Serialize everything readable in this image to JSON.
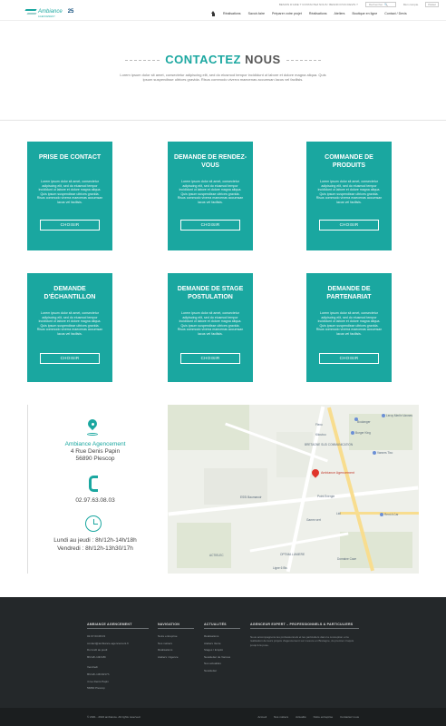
{
  "topbar": {
    "line": "BESOIN D'AIDE ? CONTACTEZ NOUS ! BESOIN D'UN DEVIS ?",
    "search_placeholder": "Rechercher",
    "account": "Mon compte",
    "panier": "Panier"
  },
  "logo": {
    "word": "Ambiance",
    "sub": "AGENCEMENT",
    "badge": "25"
  },
  "nav": {
    "items": [
      "Réalisations",
      "Savoir-faire",
      "Préparer votre projet",
      "Réalisations",
      "Ateliers",
      "Boutique en ligne",
      "Contact / Devis"
    ]
  },
  "hero": {
    "title_1": "CONTACTEZ",
    "title_2": "NOUS",
    "text": "Lorem ipsum dolor sit amet, consectetur adipiscing elit, sed do eiusmod tempor incididunt ut labore et dolore magna aliqua. Quis ipsum suspendisse ultrices gravida. Risus commodo viverra maecenas accumsan lacus vel facilisis."
  },
  "cards": [
    {
      "title": "PRISE DE CONTACT",
      "text": "Lorem ipsum dolor sit amet, consectetur adipiscing elit, sed do eiusmod tempor incididunt ut labore et dolore magna aliqua. Quis ipsum suspendisse ultrices gravida. Risus commodo viverra maecenas accumsan lacus vel facilisis.",
      "button": "CHOISIR"
    },
    {
      "title": "DEMANDE DE RENDEZ-VOUS",
      "text": "Lorem ipsum dolor sit amet, consectetur adipiscing elit, sed do eiusmod tempor incididunt ut labore et dolore magna aliqua. Quis ipsum suspendisse ultrices gravida. Risus commodo viverra maecenas accumsan lacus vel facilisis.",
      "button": "CHOISIR"
    },
    {
      "title": "COMMANDE DE PRODUITS",
      "text": "Lorem ipsum dolor sit amet, consectetur adipiscing elit, sed do eiusmod tempor incididunt ut labore et dolore magna aliqua. Quis ipsum suspendisse ultrices gravida. Risus commodo viverra maecenas accumsan lacus vel facilisis.",
      "button": "CHOISIR"
    },
    {
      "title": "DEMANDE D'ÉCHANTILLON",
      "text": "Lorem ipsum dolor sit amet, consectetur adipiscing elit, sed do eiusmod tempor incididunt ut labore et dolore magna aliqua. Quis ipsum suspendisse ultrices gravida. Risus commodo viverra maecenas accumsan lacus vel facilisis.",
      "button": "CHOISIR"
    },
    {
      "title": "DEMANDE DE STAGE POSTULATION",
      "text": "Lorem ipsum dolor sit amet, consectetur adipiscing elit, sed do eiusmod tempor incididunt ut labore et dolore magna aliqua. Quis ipsum suspendisse ultrices gravida. Risus commodo viverra maecenas accumsan lacus vel facilisis.",
      "button": "CHOISIR"
    },
    {
      "title": "DEMANDE DE PARTENARIAT",
      "text": "Lorem ipsum dolor sit amet, consectetur adipiscing elit, sed do eiusmod tempor incididunt ut labore et dolore magna aliqua. Quis ipsum suspendisse ultrices gravida. Risus commodo viverra maecenas accumsan lacus vel facilisis.",
      "button": "CHOISIR"
    }
  ],
  "contact": {
    "company": "Ambiance Agencement",
    "street": "4 Rue Denis Papin",
    "city": "56890 Plescop",
    "phone": "02.97.63.08.03",
    "hours_1": "Lundi au jeudi : 8h/12h-14h/18h",
    "hours_2": "Vendredi : 8h/12h-13h30/17h"
  },
  "map": {
    "marker_label": "Ambiance Agencement",
    "labels": [
      "Leroy Merlin Vannes",
      "Burger King",
      "Kiloutou",
      "Flexo",
      "Vannes Tixo",
      "Boulanger",
      "BRETAGNE SUD COMMUNICATION",
      "Point Energie",
      "Lidl",
      "Rent A Car",
      "Gamm vert",
      "ACTIELEC",
      "OPTIMA LUMIERE",
      "Ligne 6 Bis",
      "Domaine Cave",
      "ESSI Baumanoir"
    ]
  },
  "footer": {
    "col1": {
      "heading": "AMBIANCE AGENCEMENT",
      "lines": [
        "02.97.63.08.03",
        "contact@ambiance-agencement.fr",
        "Du lundi au jeudi",
        "8h/12h-14h/18h",
        "Vendredi",
        "8h/12h-13h30/17h",
        "4 rue Denis Papin",
        "56890 Plescop"
      ]
    },
    "col2": {
      "heading": "NAVIGATION",
      "links": [
        "Notre entreprise",
        "Nos métiers",
        "Réalisations",
        "Ateliers / Agence"
      ]
    },
    "col3": {
      "heading": "ACTUALITÉS",
      "links": [
        "Réalisations",
        "Ateliers Vente",
        "Stages / Emploi",
        "Newsletter de Vannes",
        "Nos actualités",
        "Newsletter"
      ]
    },
    "col4": {
      "heading": "AGENCEUR EXPERT – PROFESSIONNELS & PARTICULIERS",
      "text": "Nous accompagnons les professionnels et les particuliers dans la conception et la réalisation de leurs projets d'agencement sur mesure en Bretagne, du premier croquis jusqu'à la pose."
    }
  },
  "bottom": {
    "copyright": "© 2021 - 2024 ambiance. All rights reserved.",
    "links": [
      "Accueil",
      "Nos métiers",
      "Actualité",
      "Notre entreprise",
      "Contactez nous"
    ]
  },
  "colors": {
    "accent": "#1aa7a0",
    "footer_bg": "#24282a",
    "bottom_bg": "#1b1e1f"
  }
}
